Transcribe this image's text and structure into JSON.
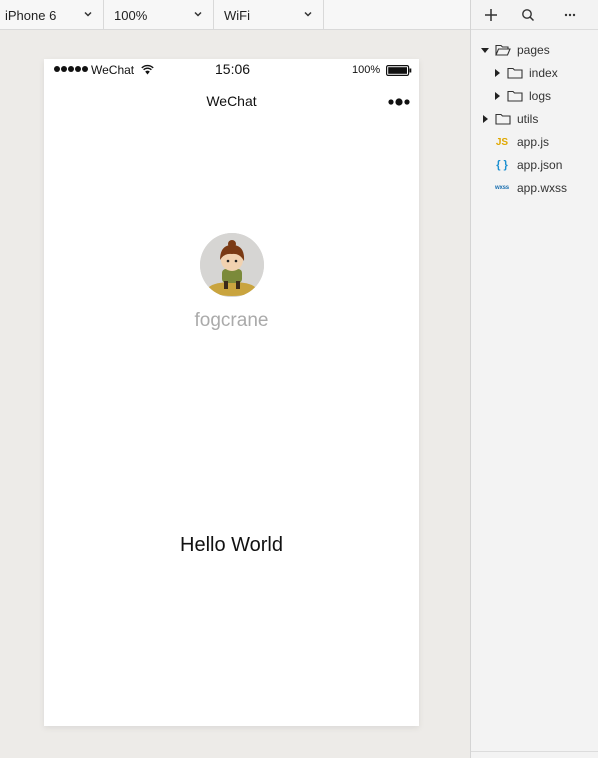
{
  "toolbar": {
    "device": "iPhone 6",
    "zoom": "100%",
    "network": "WiFi"
  },
  "phone": {
    "status": {
      "carrier": "WeChat",
      "time": "15:06",
      "battery": "100%"
    },
    "nav_title": "WeChat",
    "username": "fogcrane",
    "motto": "Hello World"
  },
  "file_tree": {
    "items": [
      {
        "label": "pages"
      },
      {
        "label": "index"
      },
      {
        "label": "logs"
      },
      {
        "label": "utils"
      },
      {
        "label": "app.js",
        "icon_text": "JS"
      },
      {
        "label": "app.json",
        "icon_text": "{ }"
      },
      {
        "label": "app.wxss",
        "icon_text": "wxss"
      }
    ]
  },
  "colors": {
    "accent_js": "#e0a800",
    "accent_json": "#1a8fd0",
    "username": "#aaaaaa"
  }
}
